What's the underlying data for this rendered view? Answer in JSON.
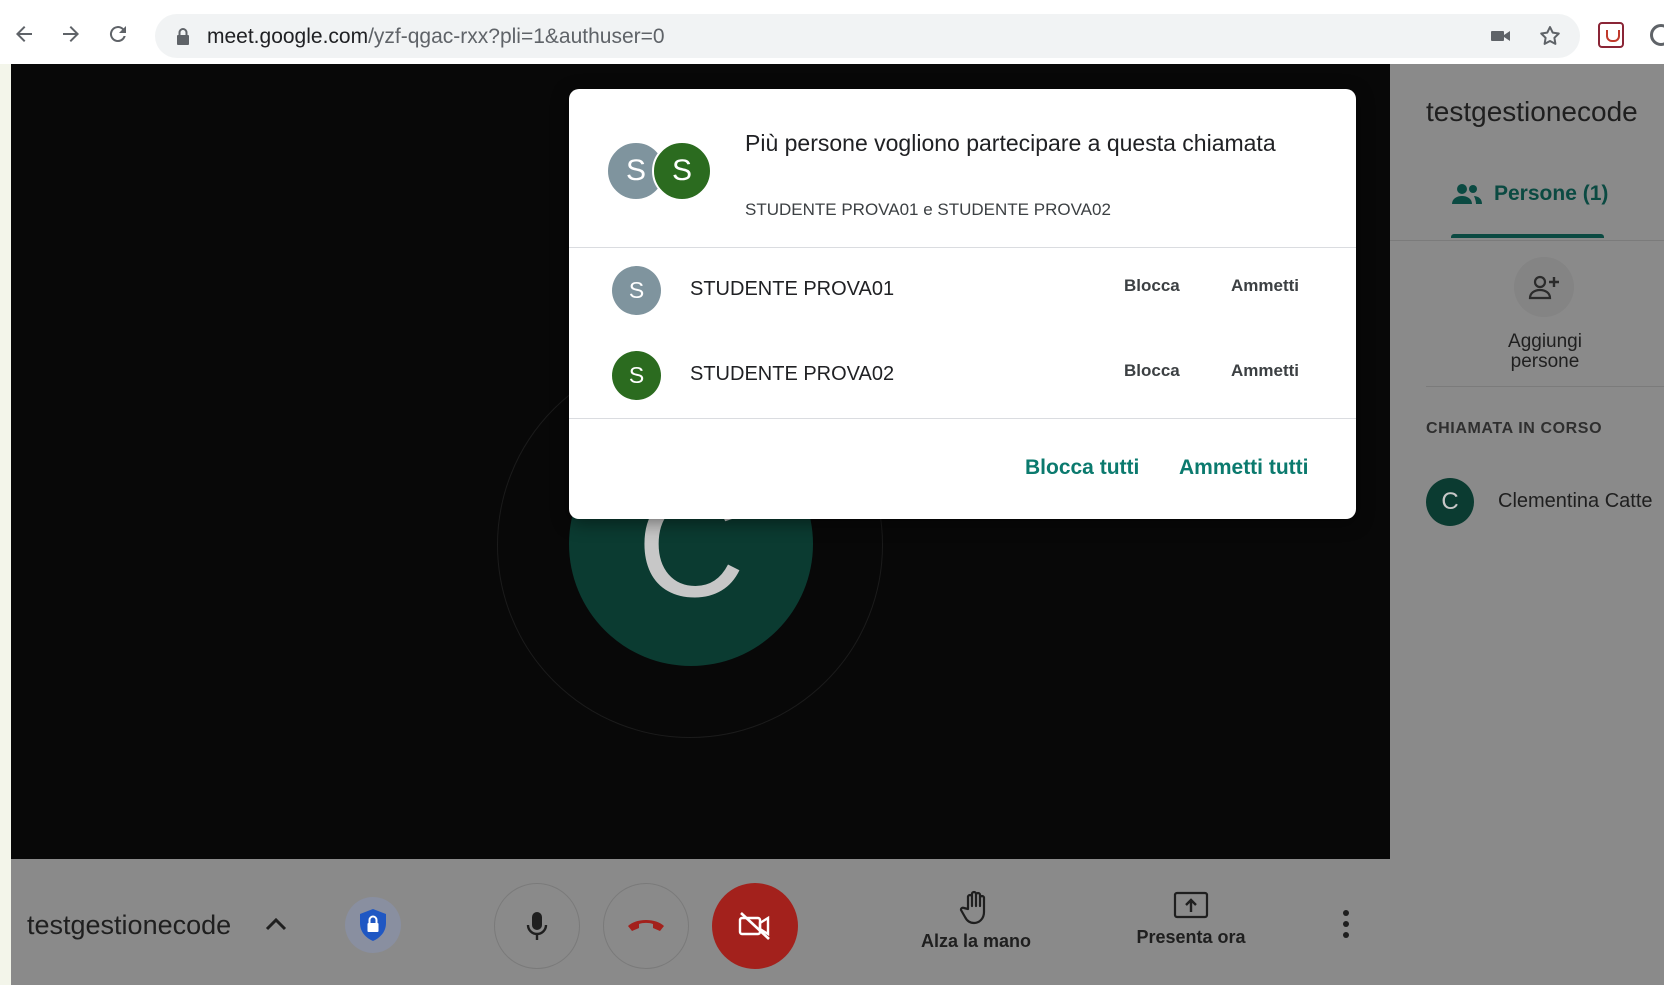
{
  "browser": {
    "url_host": "meet.google.com",
    "url_path": "/yzf-qgac-rxx?pli=1&authuser=0"
  },
  "stage": {
    "tile_initial": "C",
    "tile_color": "#0b3b31"
  },
  "side_panel": {
    "title": "testgestionecode",
    "tab_label": "Persone (1)",
    "add_people_label": "Aggiungi persone",
    "section_label": "CHIAMATA IN CORSO",
    "participant": {
      "initial": "C",
      "name": "Clementina Catte"
    }
  },
  "bottom_bar": {
    "meeting_name": "testgestionecode",
    "raise_hand_label": "Alza la mano",
    "present_label": "Presenta ora"
  },
  "dialog": {
    "avatars": [
      {
        "initial": "S",
        "color": "#7f949e"
      },
      {
        "initial": "S",
        "color": "#2b6b1f"
      }
    ],
    "title": "Più persone vogliono partecipare a questa chiamata",
    "subtitle": "STUDENTE PROVA01 e STUDENTE PROVA02",
    "requests": [
      {
        "initial": "S",
        "name": "STUDENTE PROVA01",
        "color": "#7f949e",
        "block_label": "Blocca",
        "admit_label": "Ammetti"
      },
      {
        "initial": "S",
        "name": "STUDENTE PROVA02",
        "color": "#2b6b1f",
        "block_label": "Blocca",
        "admit_label": "Ammetti"
      }
    ],
    "block_all_label": "Blocca tutti",
    "admit_all_label": "Ammetti tutti"
  },
  "colors": {
    "accent": "#0b7a6e",
    "end_call_red": "#a3211c"
  }
}
